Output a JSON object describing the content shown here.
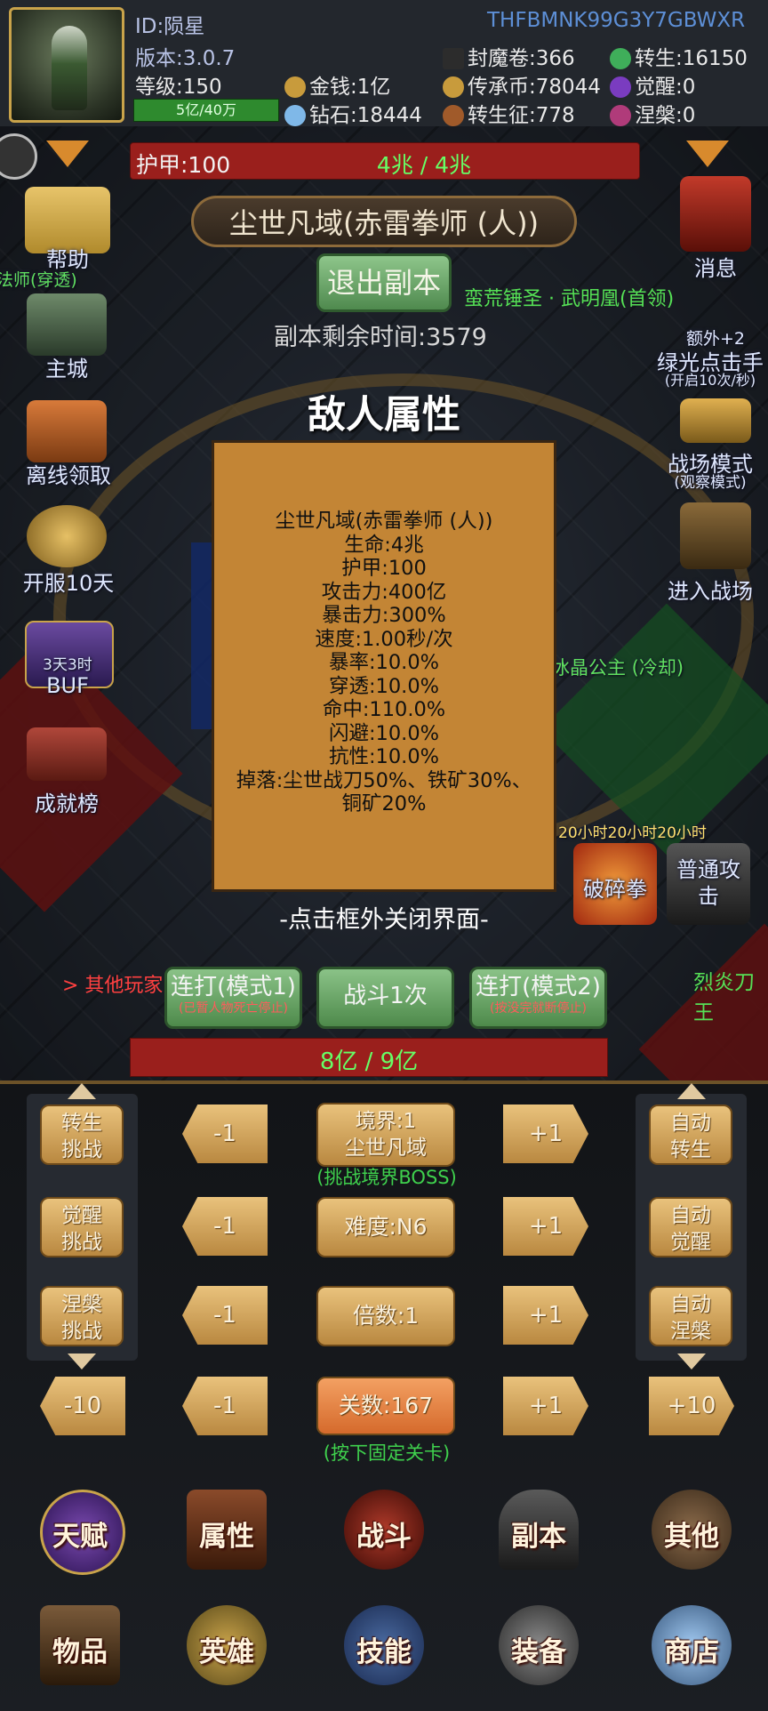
{
  "header": {
    "id_label": "ID:陨星",
    "version": "版本:3.0.7",
    "level": "等级:150",
    "exp": "5亿/40万",
    "money": "金钱:1亿",
    "diamond": "钻石:18444",
    "seal_scroll": "封魔卷:366",
    "inherit_coin": "传承币:78044",
    "rebirth_cert": "转生征:778",
    "rebirth": "转生:16150",
    "awaken": "觉醒:0",
    "nirvana": "涅槃:0",
    "code": "THFBMNK99G3Y7GBWXR"
  },
  "armor_bar": {
    "label": "护甲:100",
    "value": "4兆 / 4兆"
  },
  "dungeon": {
    "title": "尘世凡域(赤雷拳师 (人))",
    "exit_button": "退出副本",
    "remaining": "副本剩余时间:3579",
    "boss_name": "蛮荒锤圣 · 武明凰(首领)"
  },
  "left_menu": {
    "help": "帮助",
    "mage": "法师(穿透)",
    "main_city": "主城",
    "offline": "离线领取",
    "open_days": "开服10天",
    "buff": "BUF",
    "buff_badge": "3天3时",
    "achievement": "成就榜"
  },
  "right_menu": {
    "message": "消息",
    "extra": "额外+2",
    "green_click": "绿光点击手",
    "green_click_sub": "(开启10次/秒)",
    "battlefield_mode": "战场模式",
    "battlefield_mode_sub": "(观察模式)",
    "enter_battlefield": "进入战场",
    "ice_princess": "冰晶公主 (冷却)",
    "timers": "20小时20小时20小时",
    "skill_break": "破碎拳",
    "skill_normal": "普通攻击"
  },
  "modal": {
    "title": "敌人属性",
    "lines": [
      "尘世凡域(赤雷拳师 (人))",
      "生命:4兆",
      "护甲:100",
      "攻击力:400亿",
      "暴击力:300%",
      "速度:1.00秒/次",
      "暴率:10.0%",
      "穿透:10.0%",
      "命中:110.0%",
      "闪避:10.0%",
      "抗性:10.0%",
      "掉落:尘世战刀50%、铁矿30%、",
      "铜矿20%"
    ],
    "hint": "-点击框外关闭界面-"
  },
  "battle": {
    "auto1": "连打(模式1)",
    "auto1_sub": "(已暂人物死亡停止)",
    "fight_once": "战斗1次",
    "auto2": "连打(模式2)",
    "auto2_sub": "(按没完就断停止)",
    "enemy_hp": "8亿 / 9亿",
    "others": "> 其他玩家",
    "lie_blade": "烈炎刀王"
  },
  "controls": {
    "rebirth_challenge": "转生\n挑战",
    "awaken_challenge": "觉醒\n挑战",
    "nirvana_challenge": "涅槃\n挑战",
    "minus1": "-1",
    "plus1": "+1",
    "minus10": "-10",
    "plus10": "+10",
    "realm": "境界:1\n尘世凡域",
    "realm_note": "(挑战境界BOSS)",
    "difficulty": "难度:N6",
    "multiplier": "倍数:1",
    "stage": "关数:167",
    "stage_note": "(按下固定关卡)",
    "auto_rebirth": "自动\n转生",
    "auto_awaken": "自动\n觉醒",
    "auto_nirvana": "自动\n涅槃"
  },
  "nav": {
    "talent": "天赋",
    "attributes": "属性",
    "fight": "战斗",
    "dungeon": "副本",
    "other": "其他",
    "items": "物品",
    "hero": "英雄",
    "skills": "技能",
    "equipment": "装备",
    "shop": "商店"
  }
}
